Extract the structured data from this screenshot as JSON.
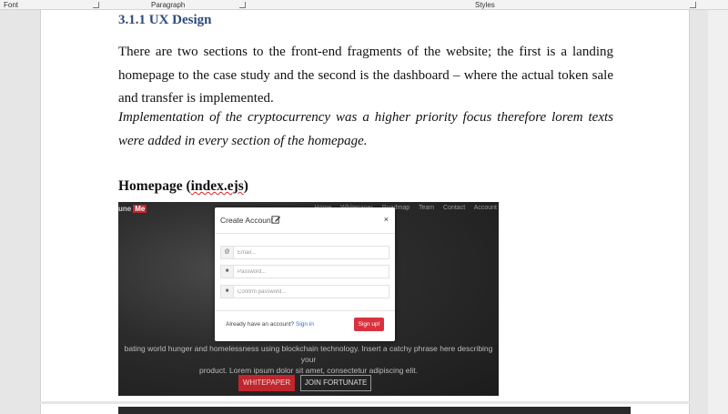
{
  "ribbon": {
    "font": "Font",
    "paragraph": "Paragraph",
    "styles": "Styles"
  },
  "doc": {
    "heading": "3.1.1 UX Design",
    "p1": "There are two sections to the front-end fragments of the website; the first is a landing homepage to the case study and the second is the dashboard – where the actual token sale and transfer is implemented.",
    "p2": "Implementation of the cryptocurrency was a higher priority focus therefore lorem texts were added in every section of the homepage.",
    "subheading_prefix": "Homepage (",
    "subheading_file": "index.ejs",
    "subheading_suffix": ")"
  },
  "screenshot": {
    "logo_a": "une",
    "logo_b": "Me",
    "nav": "Home  Whitepaper  Roadmap  Team  Contact  Account",
    "modal": {
      "title": "Create Account",
      "close": "×",
      "email_placeholder": "Email...",
      "password_placeholder": "Password...",
      "confirm_placeholder": "Confirm password...",
      "already_text": "Already have an account?",
      "signin": "Sign in",
      "signup": "Sign up!"
    },
    "hero_line1": "bating world hunger and homelessness using blockchain technology. Insert a catchy phrase here describing your",
    "hero_line2": "product. Lorem ipsum dolor sit amet, consectetur adipiscing elit.",
    "whitepaper_btn": "WHITEPAPER",
    "join_btn": "JOIN FORTUNATE"
  }
}
